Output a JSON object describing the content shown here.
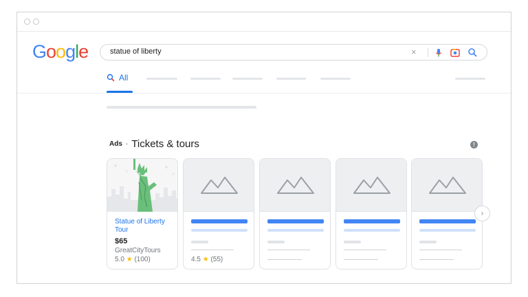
{
  "search": {
    "query": "statue of liberty",
    "clear_symbol": "×"
  },
  "logo": {
    "letters": [
      "G",
      "o",
      "o",
      "g",
      "l",
      "e"
    ]
  },
  "tabs": {
    "active_label": "All"
  },
  "ads": {
    "label": "Ads",
    "dot": "·",
    "title": "Tickets & tours",
    "info_symbol": "!"
  },
  "cards": [
    {
      "title": "Statue of Liberty Tour",
      "price": "$65",
      "vendor": "GreatCityTours",
      "rating": "5.0",
      "reviews": "(100)"
    },
    {
      "rating": "4.5",
      "reviews": "(55)"
    }
  ],
  "next_symbol": "›",
  "colors": {
    "brand_blue": "#4285F4",
    "brand_red": "#EA4335",
    "brand_yellow": "#FBBC05",
    "brand_green": "#34A853",
    "link": "#1a73e8",
    "star": "#fbbc04"
  }
}
